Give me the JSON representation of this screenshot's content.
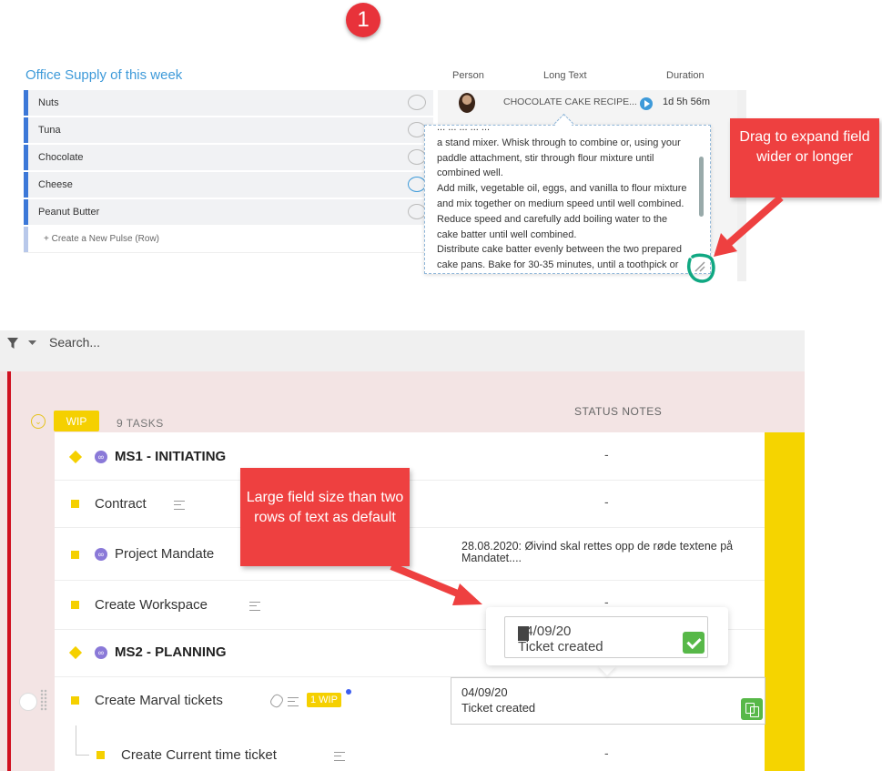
{
  "annotations": {
    "step_number": "1",
    "callout_expand": "Drag to expand field wider or longer",
    "callout_default": "Large field size than two rows of text as default"
  },
  "board": {
    "title": "Office Supply of this week",
    "columns": {
      "person": "Person",
      "long_text": "Long Text",
      "duration": "Duration"
    },
    "rows": [
      {
        "name": "Nuts"
      },
      {
        "name": "Tuna"
      },
      {
        "name": "Chocolate"
      },
      {
        "name": "Cheese"
      },
      {
        "name": "Peanut Butter"
      }
    ],
    "create_row": "+ Create a New Pulse (Row)",
    "long_text_value": "CHOCOLATE CAKE RECIPE...",
    "duration_value": "1d 5h 56m",
    "popup_lines": [
      "... ... ... ... ...",
      "a stand mixer. Whisk through to combine or, using your",
      "paddle attachment, stir through flour mixture until",
      "combined well.",
      "Add milk, vegetable oil, eggs, and vanilla to flour mixture",
      "and mix together on medium speed until well combined.",
      "Reduce speed and carefully add boiling water to the",
      "cake batter until well combined.",
      "Distribute cake batter evenly between the two prepared",
      "cake pans. Bake for 30-35 minutes, until a toothpick or"
    ]
  },
  "tasks": {
    "search_placeholder": "Search...",
    "group_label": "WIP",
    "task_count": "9 TASKS",
    "status_notes_header": "STATUS NOTES",
    "rows": [
      {
        "name": "MS1 - INITIATING",
        "status": "-"
      },
      {
        "name": "Contract",
        "status": "-"
      },
      {
        "name": "Project Mandate",
        "status": "28.08.2020: Øivind skal rettes opp de røde textene på Mandatet...."
      },
      {
        "name": "Create Workspace",
        "status": "-"
      },
      {
        "name": "MS2 - PLANNING",
        "status": ""
      },
      {
        "name": "Create Marval tickets",
        "status_date": "04/09/20",
        "status_text": "Ticket created",
        "badge": "1 WIP"
      },
      {
        "name": "Create Current time ticket",
        "status": "-"
      }
    ],
    "edit_popup": {
      "date": "04/09/20",
      "text": "Ticket created"
    }
  },
  "colors": {
    "accent": "#3c78d8",
    "callout": "#ee4040",
    "wip": "#f5d000",
    "group_bar": "#d01020",
    "teal": "#10a882"
  }
}
